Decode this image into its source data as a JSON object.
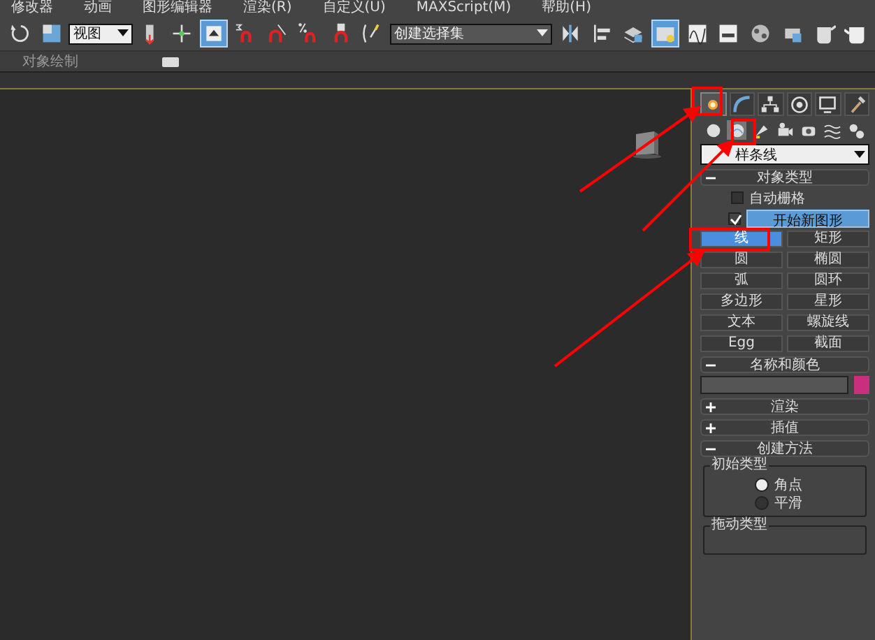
{
  "menu": [
    "修改器",
    "动画",
    "图形编辑器",
    "渲染(R)",
    "自定义(U)",
    "MAXScript(M)",
    "帮助(H)"
  ],
  "toolbar": [
    {
      "kind": "tool",
      "active": false
    },
    {
      "kind": "tool",
      "active": false
    },
    {
      "kind": "dropdown",
      "value": "视图"
    },
    {
      "kind": "tool",
      "active": false
    },
    {
      "kind": "tool",
      "active": false
    },
    {
      "kind": "tool",
      "active": true
    },
    {
      "kind": "tool",
      "active": false
    },
    {
      "kind": "tool",
      "active": false
    },
    {
      "kind": "tool",
      "active": false
    },
    {
      "kind": "tool",
      "active": false
    },
    {
      "kind": "tool",
      "active": false
    },
    {
      "kind": "dropdown",
      "value": "创建选择集"
    },
    {
      "kind": "tool",
      "active": false
    },
    {
      "kind": "tool",
      "active": false
    },
    {
      "kind": "tool",
      "active": false
    },
    {
      "kind": "tool",
      "active": true
    },
    {
      "kind": "tool",
      "active": false
    },
    {
      "kind": "tool",
      "active": false
    },
    {
      "kind": "tool",
      "active": false
    },
    {
      "kind": "tool",
      "active": false
    },
    {
      "kind": "tool",
      "active": false
    },
    {
      "kind": "tool",
      "active": false
    }
  ],
  "ribbon": {
    "label": "对象绘制"
  },
  "panel": {
    "tabs": [
      {
        "selected": true
      },
      {
        "selected": false
      },
      {
        "selected": false
      },
      {
        "selected": false
      },
      {
        "selected": false
      },
      {
        "selected": false
      }
    ],
    "categories": [
      {
        "selected": false
      },
      {
        "selected": true
      },
      {
        "selected": false
      },
      {
        "selected": false
      },
      {
        "selected": false
      },
      {
        "selected": false
      },
      {
        "selected": false
      }
    ],
    "dropdown": "样条线",
    "rollouts": [
      {
        "kind": "object_type",
        "title": "对象类型",
        "expanded": true,
        "auto_grid": {
          "label": "自动栅格",
          "checked": false
        },
        "start_new_shape": {
          "label": "开始新图形",
          "checked": true
        },
        "buttons": [
          {
            "label": "线",
            "selected": true
          },
          {
            "label": "矩形",
            "selected": false
          },
          {
            "label": "圆",
            "selected": false
          },
          {
            "label": "椭圆",
            "selected": false
          },
          {
            "label": "弧",
            "selected": false
          },
          {
            "label": "圆环",
            "selected": false
          },
          {
            "label": "多边形",
            "selected": false
          },
          {
            "label": "星形",
            "selected": false
          },
          {
            "label": "文本",
            "selected": false
          },
          {
            "label": "螺旋线",
            "selected": false
          },
          {
            "label": "Egg",
            "selected": false
          },
          {
            "label": "截面",
            "selected": false
          }
        ]
      },
      {
        "kind": "name_color",
        "title": "名称和颜色",
        "expanded": true,
        "color": "#c8307e"
      },
      {
        "kind": "plain",
        "title": "渲染",
        "expanded": false
      },
      {
        "kind": "plain",
        "title": "插值",
        "expanded": false
      },
      {
        "kind": "creation_method",
        "title": "创建方法",
        "expanded": true,
        "groups": [
          {
            "title": "初始类型",
            "options": [
              {
                "label": "角点",
                "selected": true
              },
              {
                "label": "平滑",
                "selected": false
              }
            ]
          },
          {
            "title": "拖动类型"
          }
        ]
      }
    ]
  }
}
